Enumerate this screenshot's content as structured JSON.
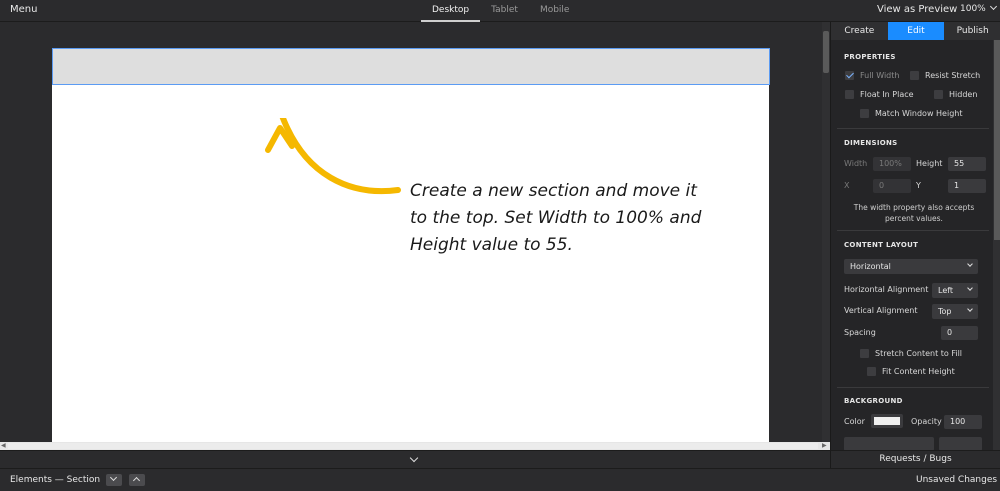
{
  "topbar": {
    "menu_label": "Menu",
    "device_tabs": [
      "Desktop",
      "Tablet",
      "Mobile"
    ],
    "active_device": "Desktop",
    "preview_label": "View as Preview",
    "zoom": "100%"
  },
  "canvas": {
    "annotation": "Create a new section and move it to the top. Set Width to 100% and Height value to 55.",
    "section_color": "#dedede",
    "selection_color": "#5b9bf3",
    "arrow_color": "#f5b800"
  },
  "panel": {
    "tabs": [
      "Create",
      "Edit",
      "Publish"
    ],
    "active_tab": "Edit",
    "accent": "#1a8cff",
    "properties": {
      "title": "PROPERTIES",
      "full_width": "Full Width",
      "resist_stretch": "Resist Stretch",
      "float_in_place": "Float In Place",
      "hidden": "Hidden",
      "match_window_height": "Match Window Height"
    },
    "dimensions": {
      "title": "DIMENSIONS",
      "width_label": "Width",
      "width_value": "100%",
      "height_label": "Height",
      "height_value": "55",
      "x_label": "X",
      "x_value": "0",
      "y_label": "Y",
      "y_value": "1",
      "note": "The width property also accepts percent values."
    },
    "content_layout": {
      "title": "CONTENT LAYOUT",
      "layout_value": "Horizontal",
      "h_align_label": "Horizontal Alignment",
      "h_align_value": "Left",
      "v_align_label": "Vertical Alignment",
      "v_align_value": "Top",
      "spacing_label": "Spacing",
      "spacing_value": "0",
      "stretch_label": "Stretch Content to Fill",
      "fit_label": "Fit Content Height"
    },
    "background": {
      "title": "BACKGROUND",
      "color_label": "Color",
      "color_value": "#efefef",
      "opacity_label": "Opacity",
      "opacity_value": "100"
    }
  },
  "bottom": {
    "requests_label": "Requests / Bugs",
    "breadcrumb": "Elements — Section",
    "status": "Unsaved Changes"
  }
}
